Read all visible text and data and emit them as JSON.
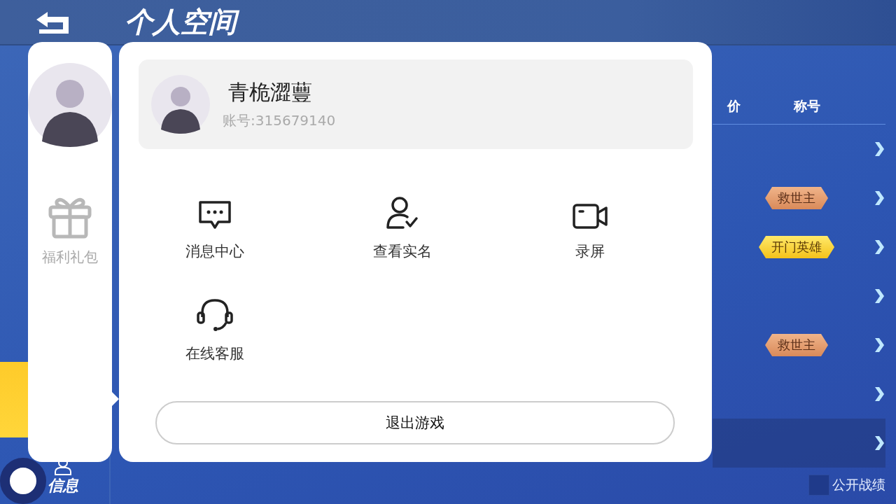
{
  "header": {
    "title": "个人空间"
  },
  "side_nav": {
    "items": [
      {
        "selected": true
      },
      {
        "label": "信息",
        "selected": false
      }
    ]
  },
  "table": {
    "columns": [
      "价",
      "称号"
    ],
    "rows": [
      {
        "selected": false
      },
      {
        "selected": false,
        "badge": {
          "text": "救世主",
          "kind": "bronze"
        }
      },
      {
        "selected": false,
        "badge": {
          "text": "开门英雄",
          "kind": "gold"
        }
      },
      {
        "selected": false
      },
      {
        "selected": false,
        "badge": {
          "text": "救世主",
          "kind": "bronze"
        }
      },
      {
        "selected": false
      },
      {
        "selected": true
      }
    ]
  },
  "public_record": {
    "label": "公开战绩",
    "checked": false
  },
  "left_card": {
    "items": [
      {
        "label": "福利礼包"
      }
    ]
  },
  "profile": {
    "name": "青桅澀蘴",
    "account": "账号:315679140"
  },
  "menu": [
    {
      "kind": "message",
      "label": "消息中心"
    },
    {
      "kind": "realname",
      "label": "查看实名"
    },
    {
      "kind": "record",
      "label": "录屏"
    },
    {
      "kind": "support",
      "label": "在线客服"
    }
  ],
  "logout_button": "退出游戏"
}
